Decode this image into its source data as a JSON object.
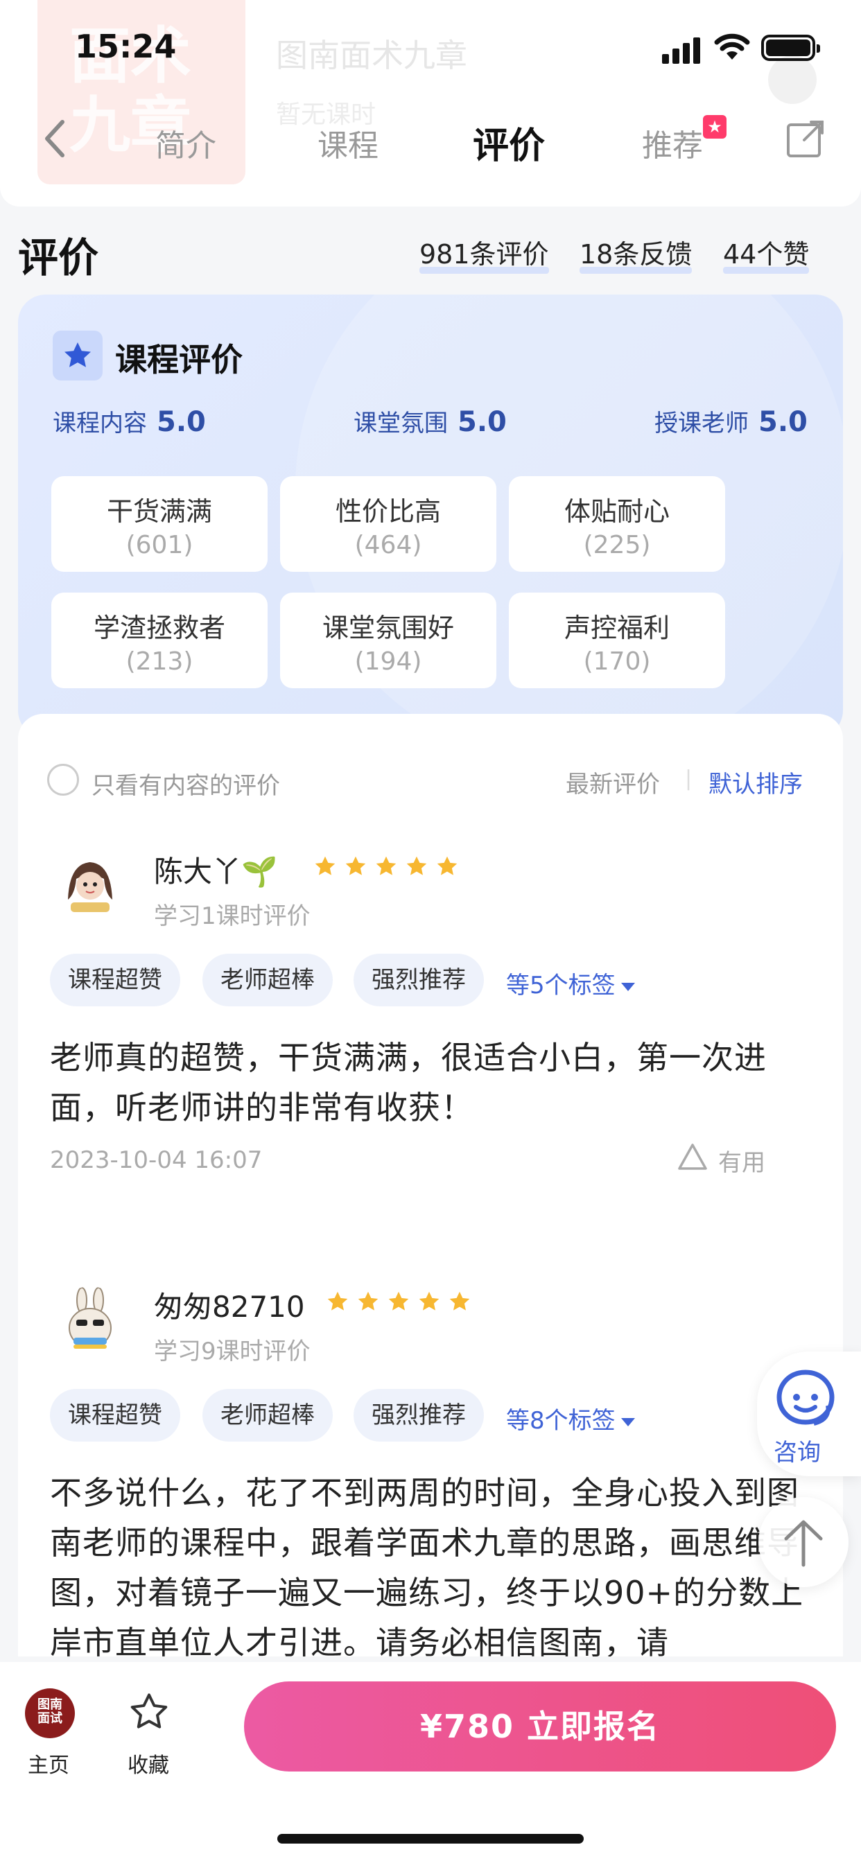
{
  "status": {
    "time": "15:24"
  },
  "header": {
    "cover_text": "面术\n九章",
    "faded_title": "图南面术九章",
    "faded_subtitle": "暂无课时"
  },
  "tabs": [
    {
      "label": "简介"
    },
    {
      "label": "课程"
    },
    {
      "label": "评价",
      "active": true
    },
    {
      "label": "推荐"
    }
  ],
  "evaluation": {
    "title": "评价",
    "stats": [
      "981条评价",
      "18条反馈",
      "44个赞"
    ]
  },
  "rating_card": {
    "title": "课程评价",
    "scores": [
      {
        "label": "课程内容",
        "value": "5.0"
      },
      {
        "label": "课堂氛围",
        "value": "5.0"
      },
      {
        "label": "授课老师",
        "value": "5.0"
      }
    ],
    "chips": [
      {
        "name": "干货满满",
        "count": "(601)"
      },
      {
        "name": "性价比高",
        "count": "(464)"
      },
      {
        "name": "体贴耐心",
        "count": "(225)"
      },
      {
        "name": "学渣拯救者",
        "count": "(213)"
      },
      {
        "name": "课堂氛围好",
        "count": "(194)"
      },
      {
        "name": "声控福利",
        "count": "(170)"
      }
    ]
  },
  "reviews": {
    "filter_label": "只看有内容的评价",
    "sort_latest": "最新评价",
    "sort_default": "默认排序",
    "items": [
      {
        "user": "陈大丫🌱",
        "meta": "学习1课时评价",
        "stars": 5,
        "tags": [
          "课程超赞",
          "老师超棒",
          "强烈推荐"
        ],
        "more_tags": "等5个标签",
        "content": "老师真的超赞，干货满满，很适合小白，第一次进面，听老师讲的非常有收获！",
        "date": "2023-10-04 16:07",
        "useful": "有用"
      },
      {
        "user": "匆匆82710",
        "meta": "学习9课时评价",
        "stars": 5,
        "tags": [
          "课程超赞",
          "老师超棒",
          "强烈推荐"
        ],
        "more_tags": "等8个标签",
        "content": "不多说什么，花了不到两周的时间，全身心投入到图南老师的课程中，跟着学面术九章的思路，画思维导图，对着镜子一遍又一遍练习，终于以90+的分数上岸市直单位人才引进。请务必相信图南，请"
      }
    ]
  },
  "floating": {
    "consult_label": "咨询"
  },
  "bottom_bar": {
    "home_logo": "图南\n面试",
    "home_label": "主页",
    "fav_label": "收藏",
    "cta_label": "¥780  立即报名"
  },
  "colors": {
    "accent_blue": "#3f63d6",
    "cta_start": "#ec5aa3",
    "cta_end": "#ee4f77",
    "star": "#f7b731"
  }
}
